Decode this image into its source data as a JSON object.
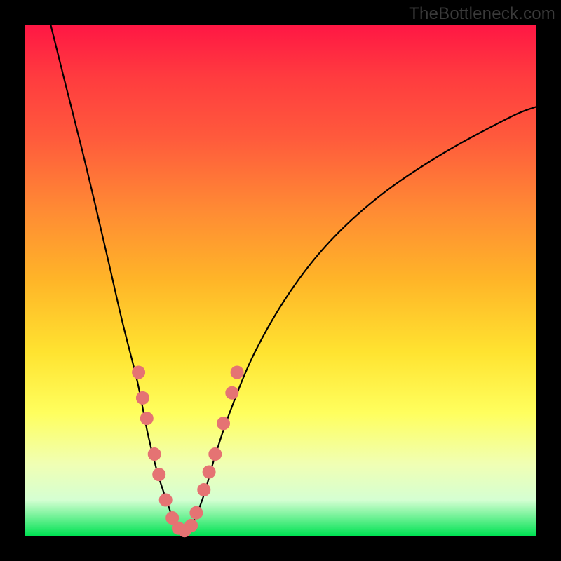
{
  "watermark": "TheBottleneck.com",
  "chart_data": {
    "type": "line",
    "title": "",
    "xlabel": "",
    "ylabel": "",
    "xlim": [
      0,
      100
    ],
    "ylim": [
      0,
      100
    ],
    "background_gradient_stops": [
      {
        "pos": 0,
        "color": "#ff1744"
      },
      {
        "pos": 10,
        "color": "#ff3b3f"
      },
      {
        "pos": 22,
        "color": "#ff5a3c"
      },
      {
        "pos": 36,
        "color": "#ff8a34"
      },
      {
        "pos": 50,
        "color": "#ffb528"
      },
      {
        "pos": 64,
        "color": "#ffe330"
      },
      {
        "pos": 76,
        "color": "#ffff5e"
      },
      {
        "pos": 86,
        "color": "#f0ffb4"
      },
      {
        "pos": 93,
        "color": "#d5ffd2"
      },
      {
        "pos": 100,
        "color": "#00e253"
      }
    ],
    "series": [
      {
        "name": "bottleneck-curve",
        "x": [
          5,
          8,
          12,
          16,
          19,
          22,
          24,
          26,
          28,
          29.5,
          31,
          33,
          35,
          37,
          40,
          45,
          52,
          60,
          70,
          82,
          95,
          100
        ],
        "y": [
          100,
          88,
          72,
          55,
          42,
          30,
          20,
          12,
          6,
          2,
          1,
          3,
          8,
          15,
          24,
          36,
          48,
          58,
          67,
          75,
          82,
          84
        ]
      }
    ],
    "markers": {
      "name": "highlight-dots",
      "color": "#e57373",
      "points": [
        {
          "x": 22.2,
          "y": 32
        },
        {
          "x": 23.0,
          "y": 27
        },
        {
          "x": 23.8,
          "y": 23
        },
        {
          "x": 25.3,
          "y": 16
        },
        {
          "x": 26.2,
          "y": 12
        },
        {
          "x": 27.5,
          "y": 7
        },
        {
          "x": 28.8,
          "y": 3.5
        },
        {
          "x": 30.0,
          "y": 1.5
        },
        {
          "x": 31.2,
          "y": 1
        },
        {
          "x": 32.5,
          "y": 2
        },
        {
          "x": 33.5,
          "y": 4.5
        },
        {
          "x": 35.0,
          "y": 9
        },
        {
          "x": 36.0,
          "y": 12.5
        },
        {
          "x": 37.2,
          "y": 16
        },
        {
          "x": 38.8,
          "y": 22
        },
        {
          "x": 40.5,
          "y": 28
        },
        {
          "x": 41.5,
          "y": 32
        }
      ]
    }
  }
}
